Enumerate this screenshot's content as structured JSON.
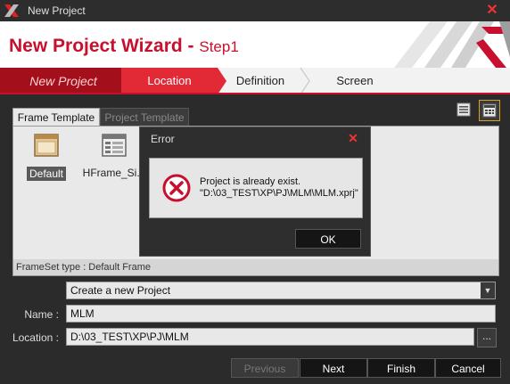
{
  "window": {
    "title": "New Project"
  },
  "header": {
    "title": "New Project Wizard - ",
    "step": "Step1"
  },
  "steps": [
    {
      "label": "New Project"
    },
    {
      "label": "Location"
    },
    {
      "label": "Definition"
    },
    {
      "label": "Screen"
    }
  ],
  "template_tabs": {
    "frame": "Frame Template",
    "project": "Project Template"
  },
  "templates": [
    {
      "label": "Default"
    },
    {
      "label": "HFrame_Si..."
    }
  ],
  "panel_footer": "FrameSet type : Default Frame",
  "form": {
    "mode": "Create a new Project",
    "name_label": "Name :",
    "name_value": "MLM",
    "location_label": "Location :",
    "location_value": "D:\\03_TEST\\XP\\PJ\\MLM",
    "browse": "..."
  },
  "buttons": {
    "previous": "Previous",
    "next": "Next",
    "finish": "Finish",
    "cancel": "Cancel"
  },
  "dialog": {
    "title": "Error",
    "line1": "Project is already exist.",
    "line2": "\"D:\\03_TEST\\XP\\PJ\\MLM\\MLM.xprj\"",
    "ok": "OK"
  },
  "colors": {
    "accent": "#c8102e",
    "active_step": "#e12a36",
    "dark": "#2b2b2b"
  }
}
